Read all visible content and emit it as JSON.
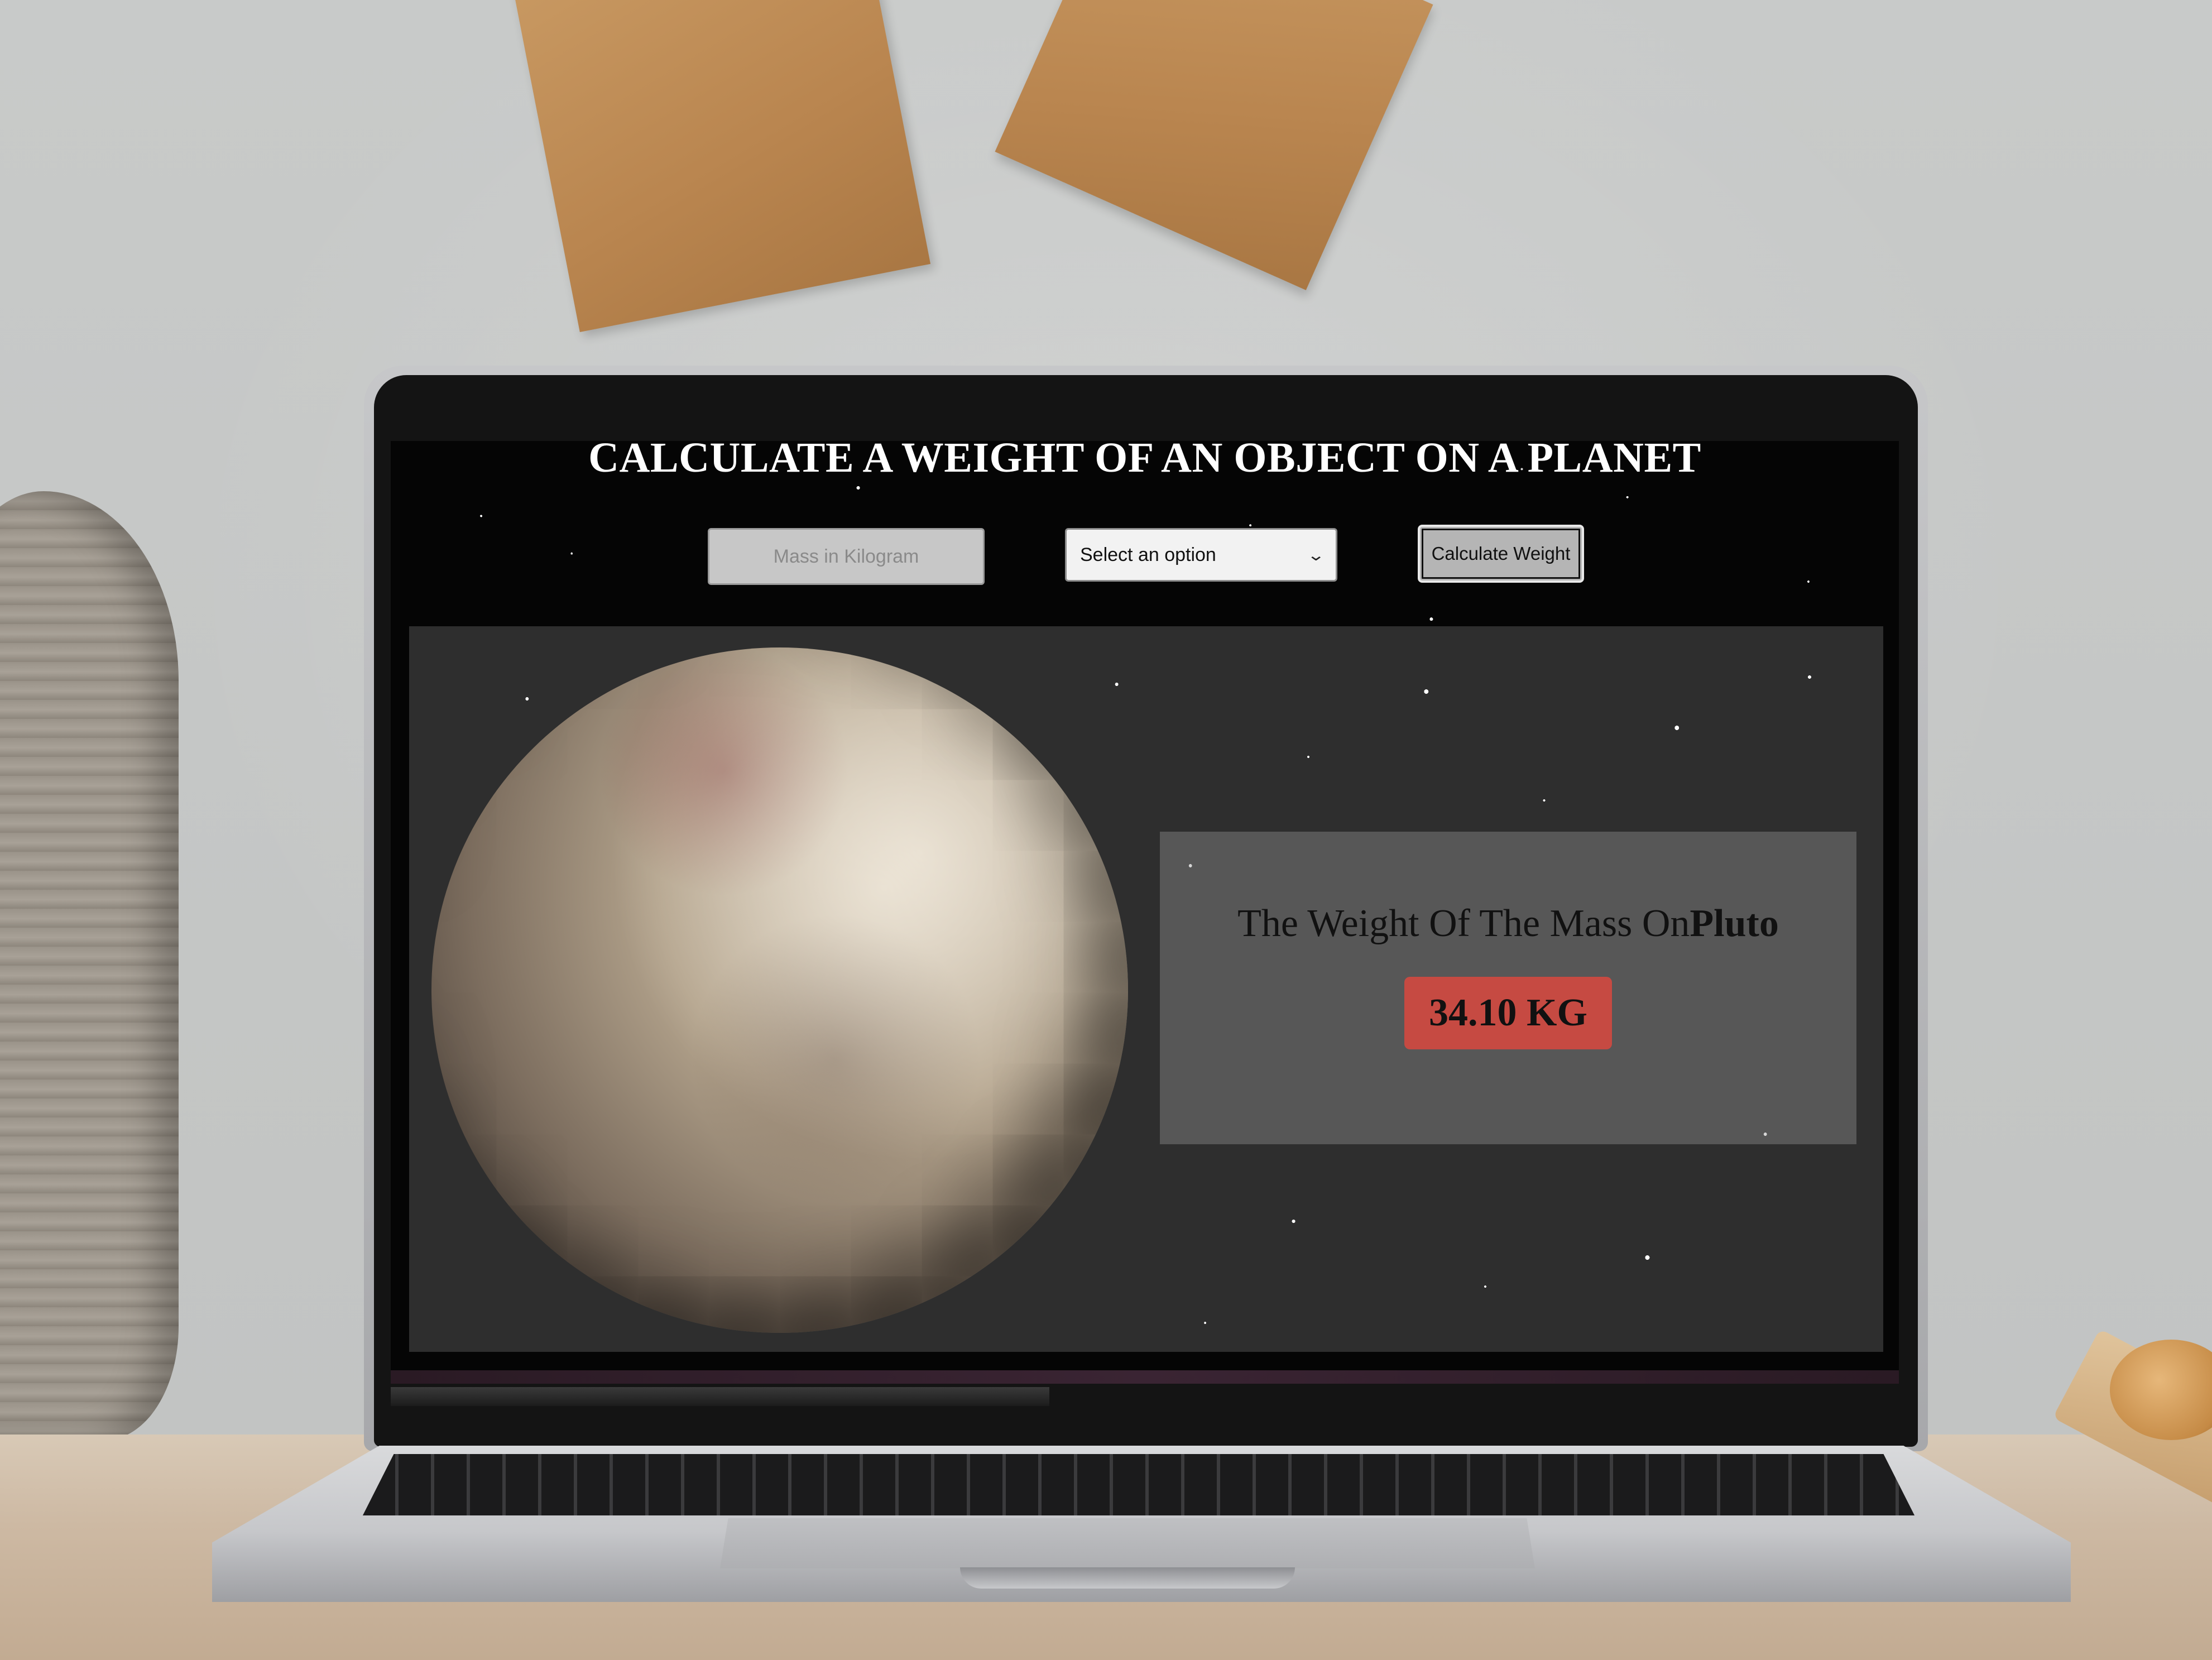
{
  "app": {
    "title": "CALCULATE A WEIGHT OF AN OBJECT ON A PLANET"
  },
  "form": {
    "mass_placeholder": "Mass in Kilogram",
    "mass_value": "",
    "planet_select_label": "Select an option",
    "calculate_label": "Calculate Weight"
  },
  "result": {
    "prefix": "The Weight Of The Mass On",
    "planet": "Pluto",
    "value": "34.10 KG"
  },
  "colors": {
    "result_badge": "#c64a42",
    "screen_background": "#050505",
    "panel_background": "#2e2e2e"
  },
  "icons": {
    "select_chevron": "chevron-down-icon"
  }
}
